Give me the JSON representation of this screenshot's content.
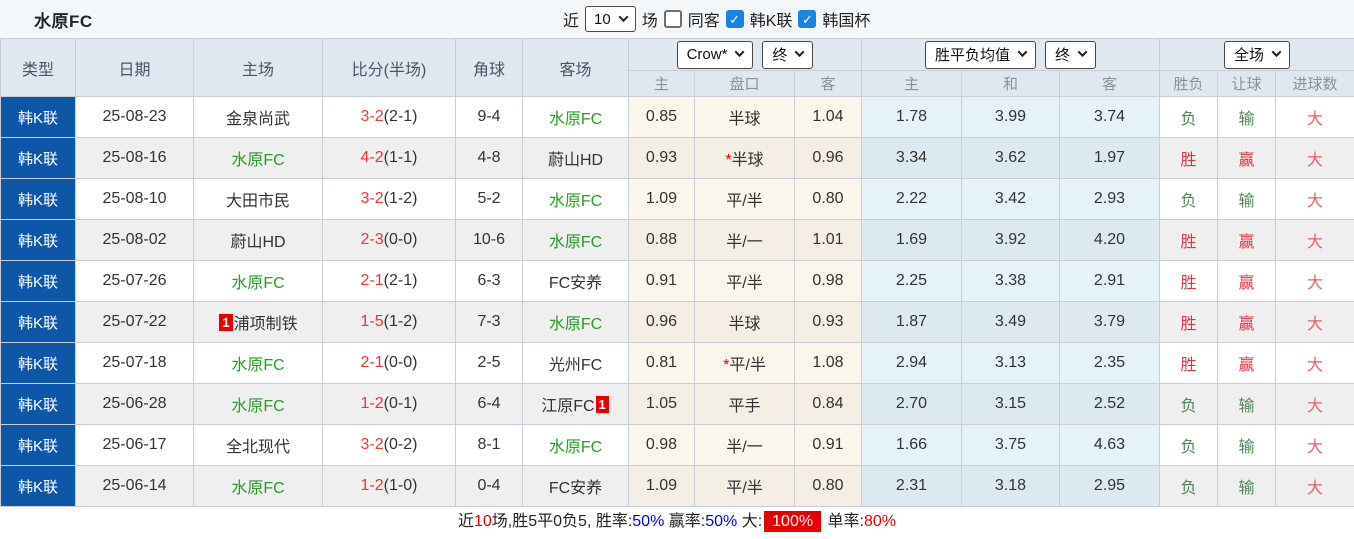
{
  "title": "水原FC",
  "controls": {
    "recent_label": "近",
    "recent_value": "10",
    "matches_label": "场",
    "same_away": {
      "label": "同客",
      "checked": false
    },
    "league_filter": {
      "label": "韩K联",
      "checked": true
    },
    "cup_filter": {
      "label": "韩国杯",
      "checked": true
    },
    "check_glyph": "✓"
  },
  "table": {
    "columns": {
      "type": "类型",
      "date": "日期",
      "home": "主场",
      "score": "比分(半场)",
      "corners": "角球",
      "away": "客场",
      "sub": [
        "主",
        "盘口",
        "客",
        "主",
        "和",
        "客",
        "胜负",
        "让球",
        "进球数"
      ]
    },
    "selects": {
      "bookmaker": "Crow*",
      "asia_time": "终",
      "europe": "胜平负均值",
      "europe_time": "终",
      "scope": "全场"
    },
    "rows": [
      {
        "league": "韩K联",
        "date": "25-08-23",
        "home": {
          "name": "金泉尚武",
          "self": false,
          "badge": ""
        },
        "score": {
          "ft": "3-2",
          "ht": "(2-1)"
        },
        "corners": "9-4",
        "away": {
          "name": "水原FC",
          "self": true,
          "badge": ""
        },
        "asia": {
          "home": "0.85",
          "star": false,
          "line": "半球",
          "away": "1.04"
        },
        "euro": {
          "home": "1.78",
          "draw": "3.99",
          "away": "3.74"
        },
        "results": {
          "outcome": {
            "text": "负",
            "state": "loss"
          },
          "handicap": {
            "text": "输",
            "state": "loss"
          },
          "goals": {
            "text": "大",
            "state": "over"
          }
        }
      },
      {
        "league": "韩K联",
        "date": "25-08-16",
        "home": {
          "name": "水原FC",
          "self": true,
          "badge": ""
        },
        "score": {
          "ft": "4-2",
          "ht": "(1-1)"
        },
        "corners": "4-8",
        "away": {
          "name": "蔚山HD",
          "self": false,
          "badge": ""
        },
        "asia": {
          "home": "0.93",
          "star": true,
          "line": "半球",
          "away": "0.96"
        },
        "euro": {
          "home": "3.34",
          "draw": "3.62",
          "away": "1.97"
        },
        "results": {
          "outcome": {
            "text": "胜",
            "state": "win"
          },
          "handicap": {
            "text": "赢",
            "state": "win"
          },
          "goals": {
            "text": "大",
            "state": "over"
          }
        }
      },
      {
        "league": "韩K联",
        "date": "25-08-10",
        "home": {
          "name": "大田市民",
          "self": false,
          "badge": ""
        },
        "score": {
          "ft": "3-2",
          "ht": "(1-2)"
        },
        "corners": "5-2",
        "away": {
          "name": "水原FC",
          "self": true,
          "badge": ""
        },
        "asia": {
          "home": "1.09",
          "star": false,
          "line": "平/半",
          "away": "0.80"
        },
        "euro": {
          "home": "2.22",
          "draw": "3.42",
          "away": "2.93"
        },
        "results": {
          "outcome": {
            "text": "负",
            "state": "loss"
          },
          "handicap": {
            "text": "输",
            "state": "loss"
          },
          "goals": {
            "text": "大",
            "state": "over"
          }
        }
      },
      {
        "league": "韩K联",
        "date": "25-08-02",
        "home": {
          "name": "蔚山HD",
          "self": false,
          "badge": ""
        },
        "score": {
          "ft": "2-3",
          "ht": "(0-0)"
        },
        "corners": "10-6",
        "away": {
          "name": "水原FC",
          "self": true,
          "badge": ""
        },
        "asia": {
          "home": "0.88",
          "star": false,
          "line": "半/一",
          "away": "1.01"
        },
        "euro": {
          "home": "1.69",
          "draw": "3.92",
          "away": "4.20"
        },
        "results": {
          "outcome": {
            "text": "胜",
            "state": "win"
          },
          "handicap": {
            "text": "赢",
            "state": "win"
          },
          "goals": {
            "text": "大",
            "state": "over"
          }
        }
      },
      {
        "league": "韩K联",
        "date": "25-07-26",
        "home": {
          "name": "水原FC",
          "self": true,
          "badge": ""
        },
        "score": {
          "ft": "2-1",
          "ht": "(2-1)"
        },
        "corners": "6-3",
        "away": {
          "name": "FC安养",
          "self": false,
          "badge": ""
        },
        "asia": {
          "home": "0.91",
          "star": false,
          "line": "平/半",
          "away": "0.98"
        },
        "euro": {
          "home": "2.25",
          "draw": "3.38",
          "away": "2.91"
        },
        "results": {
          "outcome": {
            "text": "胜",
            "state": "win"
          },
          "handicap": {
            "text": "赢",
            "state": "win"
          },
          "goals": {
            "text": "大",
            "state": "over"
          }
        }
      },
      {
        "league": "韩K联",
        "date": "25-07-22",
        "home": {
          "name": "浦项制铁",
          "self": false,
          "badge": "1"
        },
        "score": {
          "ft": "1-5",
          "ht": "(1-2)"
        },
        "corners": "7-3",
        "away": {
          "name": "水原FC",
          "self": true,
          "badge": ""
        },
        "asia": {
          "home": "0.96",
          "star": false,
          "line": "半球",
          "away": "0.93"
        },
        "euro": {
          "home": "1.87",
          "draw": "3.49",
          "away": "3.79"
        },
        "results": {
          "outcome": {
            "text": "胜",
            "state": "win"
          },
          "handicap": {
            "text": "赢",
            "state": "win"
          },
          "goals": {
            "text": "大",
            "state": "over"
          }
        }
      },
      {
        "league": "韩K联",
        "date": "25-07-18",
        "home": {
          "name": "水原FC",
          "self": true,
          "badge": ""
        },
        "score": {
          "ft": "2-1",
          "ht": "(0-0)"
        },
        "corners": "2-5",
        "away": {
          "name": "光州FC",
          "self": false,
          "badge": ""
        },
        "asia": {
          "home": "0.81",
          "star": true,
          "line": "平/半",
          "away": "1.08"
        },
        "euro": {
          "home": "2.94",
          "draw": "3.13",
          "away": "2.35"
        },
        "results": {
          "outcome": {
            "text": "胜",
            "state": "win"
          },
          "handicap": {
            "text": "赢",
            "state": "win"
          },
          "goals": {
            "text": "大",
            "state": "over"
          }
        }
      },
      {
        "league": "韩K联",
        "date": "25-06-28",
        "home": {
          "name": "水原FC",
          "self": true,
          "badge": ""
        },
        "score": {
          "ft": "1-2",
          "ht": "(0-1)"
        },
        "corners": "6-4",
        "away": {
          "name": "江原FC",
          "self": false,
          "badge": "1"
        },
        "asia": {
          "home": "1.05",
          "star": false,
          "line": "平手",
          "away": "0.84"
        },
        "euro": {
          "home": "2.70",
          "draw": "3.15",
          "away": "2.52"
        },
        "results": {
          "outcome": {
            "text": "负",
            "state": "loss"
          },
          "handicap": {
            "text": "输",
            "state": "loss"
          },
          "goals": {
            "text": "大",
            "state": "over"
          }
        }
      },
      {
        "league": "韩K联",
        "date": "25-06-17",
        "home": {
          "name": "全北现代",
          "self": false,
          "badge": ""
        },
        "score": {
          "ft": "3-2",
          "ht": "(0-2)"
        },
        "corners": "8-1",
        "away": {
          "name": "水原FC",
          "self": true,
          "badge": ""
        },
        "asia": {
          "home": "0.98",
          "star": false,
          "line": "半/一",
          "away": "0.91"
        },
        "euro": {
          "home": "1.66",
          "draw": "3.75",
          "away": "4.63"
        },
        "results": {
          "outcome": {
            "text": "负",
            "state": "loss"
          },
          "handicap": {
            "text": "输",
            "state": "loss"
          },
          "goals": {
            "text": "大",
            "state": "over"
          }
        }
      },
      {
        "league": "韩K联",
        "date": "25-06-14",
        "home": {
          "name": "水原FC",
          "self": true,
          "badge": ""
        },
        "score": {
          "ft": "1-2",
          "ht": "(1-0)"
        },
        "corners": "0-4",
        "away": {
          "name": "FC安养",
          "self": false,
          "badge": ""
        },
        "asia": {
          "home": "1.09",
          "star": false,
          "line": "平/半",
          "away": "0.80"
        },
        "euro": {
          "home": "2.31",
          "draw": "3.18",
          "away": "2.95"
        },
        "results": {
          "outcome": {
            "text": "负",
            "state": "loss"
          },
          "handicap": {
            "text": "输",
            "state": "loss"
          },
          "goals": {
            "text": "大",
            "state": "over"
          }
        }
      }
    ]
  },
  "summary": {
    "parts": [
      {
        "text": "近",
        "style": "plain"
      },
      {
        "text": "10",
        "style": "red"
      },
      {
        "text": "场,胜5平0负5, 胜率:",
        "style": "plain"
      },
      {
        "text": "50%",
        "style": "blue"
      },
      {
        "text": " 赢率:",
        "style": "plain"
      },
      {
        "text": "50%",
        "style": "blue"
      },
      {
        "text": " 大:",
        "style": "plain"
      },
      {
        "text": "100%",
        "style": "red-box"
      },
      {
        "text": " 单率:",
        "style": "plain"
      },
      {
        "text": "80%",
        "style": "red"
      }
    ]
  },
  "colors": {
    "league_bg": "#0e57a8",
    "header_bg": "#dfe7f0",
    "self_team": "#2a9b2a",
    "score_red": "#e53935",
    "badge_red": "#e60000",
    "win_red": "#d23a4a",
    "loss_green": "#53855a",
    "over_red": "#e8616d",
    "pct_blue": "#0000e0",
    "checkbox_blue": "#1a82e2"
  }
}
